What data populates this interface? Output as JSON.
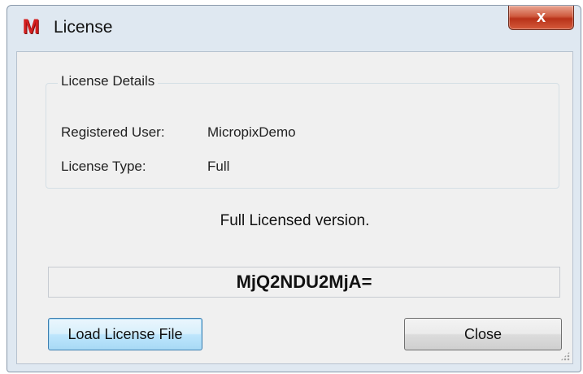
{
  "window": {
    "title": "License",
    "app_icon_letter": "M",
    "close_glyph": "x"
  },
  "details": {
    "group_title": "License Details",
    "registered_user_label": "Registered User:",
    "registered_user_value": "MicropixDemo",
    "license_type_label": "License Type:",
    "license_type_value": "Full"
  },
  "status": {
    "text": "Full Licensed version."
  },
  "license_key": "MjQ2NDU2MjA=",
  "buttons": {
    "load_license_file": "Load License File",
    "close": "Close"
  },
  "colors": {
    "accent_focus": "#3c7fb1",
    "close_button": "#c8432a",
    "icon_red": "#d41f1f"
  }
}
